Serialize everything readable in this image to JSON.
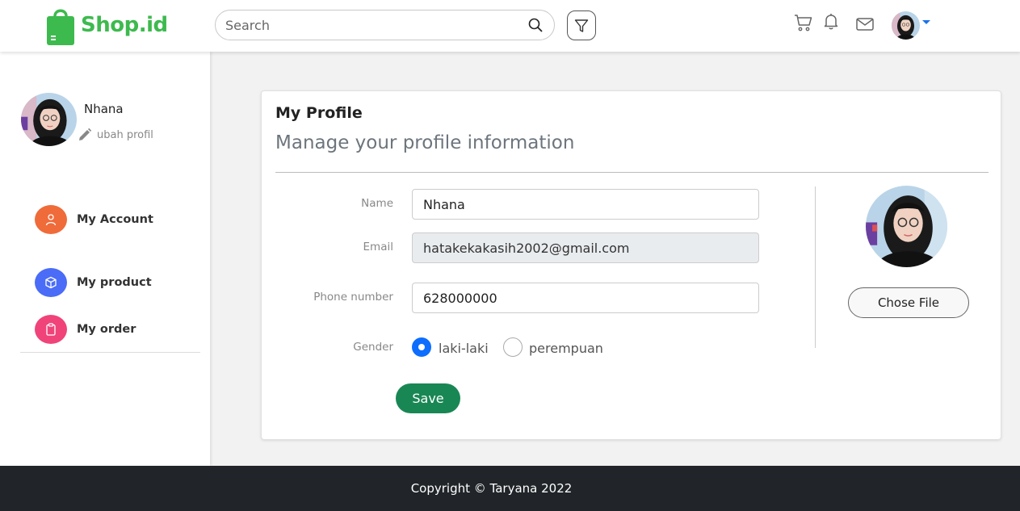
{
  "header": {
    "logo_text": "Shop.id",
    "search_placeholder": "Search",
    "icons": [
      "shopping-bag-icon",
      "search-icon",
      "filter-icon",
      "cart-icon",
      "bell-icon",
      "mail-icon",
      "avatar",
      "caret-down-icon"
    ]
  },
  "sidebar": {
    "user_name": "Nhana",
    "edit_profile_label": "ubah profil",
    "menu": [
      {
        "label": "My Account",
        "icon": "person-icon",
        "color": "#f06b3a"
      },
      {
        "label": "My product",
        "icon": "box-icon",
        "color": "#4a6cf7"
      },
      {
        "label": "My order",
        "icon": "clipboard-icon",
        "color": "#f0437a"
      }
    ]
  },
  "profile": {
    "title": "My Profile",
    "subtitle": "Manage your profile information",
    "fields": {
      "name_label": "Name",
      "name_value": "Nhana",
      "email_label": "Email",
      "email_value": "hatakekakasih2002@gmail.com",
      "phone_label": "Phone number",
      "phone_value": "628000000",
      "gender_label": "Gender",
      "gender_options": [
        "laki-laki",
        "perempuan"
      ],
      "gender_selected": "laki-laki"
    },
    "save_label": "Save",
    "choose_file_label": "Chose File"
  },
  "footer": {
    "copyright": "Copyright © Taryana 2022"
  },
  "colors": {
    "brand_green": "#3dba4e",
    "save_green": "#198754",
    "radio_blue": "#0d6efd",
    "footer_bg": "#212529"
  }
}
